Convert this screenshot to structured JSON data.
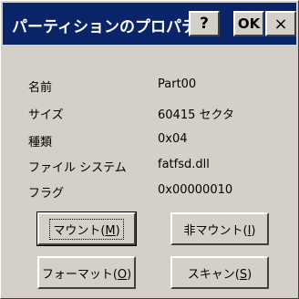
{
  "window": {
    "title": "パーティションのプロパティ",
    "help_label": "?",
    "ok_label": "OK",
    "close_label": "×"
  },
  "properties": [
    {
      "label": "名前",
      "value": "Part00"
    },
    {
      "label": "サイズ",
      "value": "60415 セクタ"
    },
    {
      "label": "種類",
      "value": "0x04"
    },
    {
      "label": "ファイル システム",
      "value": "fatfsd.dll"
    },
    {
      "label": "フラグ",
      "value": "0x00000010"
    }
  ],
  "buttons": {
    "mount": {
      "text": "マウント(",
      "accel": "M",
      "close": ")"
    },
    "unmount": {
      "text": "非マウント(",
      "accel": "I",
      "close": ")"
    },
    "format": {
      "text": "フォーマット(",
      "accel": "O",
      "close": ")"
    },
    "scan": {
      "text": "スキャン(",
      "accel": "S",
      "close": ")"
    }
  }
}
